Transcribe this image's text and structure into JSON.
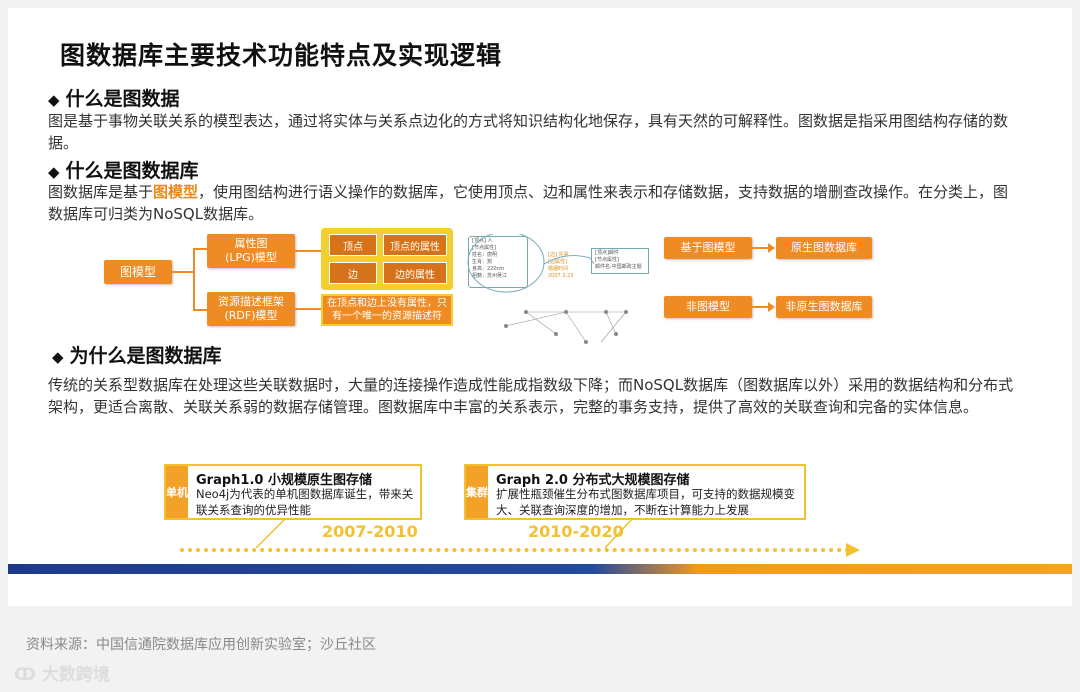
{
  "title": "图数据库主要技术功能特点及实现逻辑",
  "sections": [
    {
      "heading": "什么是图数据",
      "text": "图是基于事物关联关系的模型表达，通过将实体与关系点边化的方式将知识结构化地保存，具有天然的可解释性。图数据是指采用图结构存储的数据。"
    },
    {
      "heading": "什么是图数据库",
      "text_pre": "图数据库是基于",
      "text_hl": "图模型",
      "text_post": "，使用图结构进行语义操作的数据库，它使用顶点、边和属性来表示和存储数据，支持数据的增删查改操作。在分类上，图数据库可归类为NoSQL数据库。"
    },
    {
      "heading": "为什么是图数据库",
      "text": "传统的关系型数据库在处理这些关联数据时，大量的连接操作造成性能成指数级下降；而NoSQL数据库（图数据库以外）采用的数据结构和分布式架构，更适合离散、关联关系弱的数据存储管理。图数据库中丰富的关系表示，完整的事务支持，提供了高效的关联查询和完备的实体信息。"
    }
  ],
  "diagram": {
    "root": "图模型",
    "lpg": "属性图\n(LPG)模型",
    "rdf": "资源描述框架\n(RDF)模型",
    "props": [
      "顶点",
      "顶点的属性",
      "边",
      "边的属性"
    ],
    "rdf_note": "在顶点和边上没有属性，只有一个唯一的资源描述符",
    "mini_a": "[顶点] 人\n[节点属性]\n姓名：唐明\n生肖：狗\n身高：220cm\n祖籍：苏州吴江",
    "mini_b": "[边] 先妻\n[边属性]\n婚姻时间\n2007.2.23",
    "mini_c": "[顶点]邮件\n[节点属性]\n邮件名:中国邮政主题",
    "graph_based": "基于图模型",
    "native": "原生图数据库",
    "non_graph": "非图模型",
    "non_native": "非原生图数据库"
  },
  "timeline": [
    {
      "tag": "单机",
      "title": "Graph1.0  小规模原生图存储",
      "body": "Neo4j为代表的单机图数据库诞生，带来关联关系查询的优异性能",
      "year": "2007-2010"
    },
    {
      "tag": "集群",
      "title": "Graph 2.0  分布式大规模图存储",
      "body": "扩展性瓶颈催生分布式图数据库项目，可支持的数据规模变大、关联查询深度的增加，不断在计算能力上发展",
      "year": "2010-2020"
    }
  ],
  "source": "资料来源：中国信通院数据库应用创新实验室；沙丘社区",
  "watermark": "大数跨境",
  "colors": {
    "orange": "#ee8b25",
    "yellow": "#f2c12e",
    "navy": "#1f3a8a"
  }
}
